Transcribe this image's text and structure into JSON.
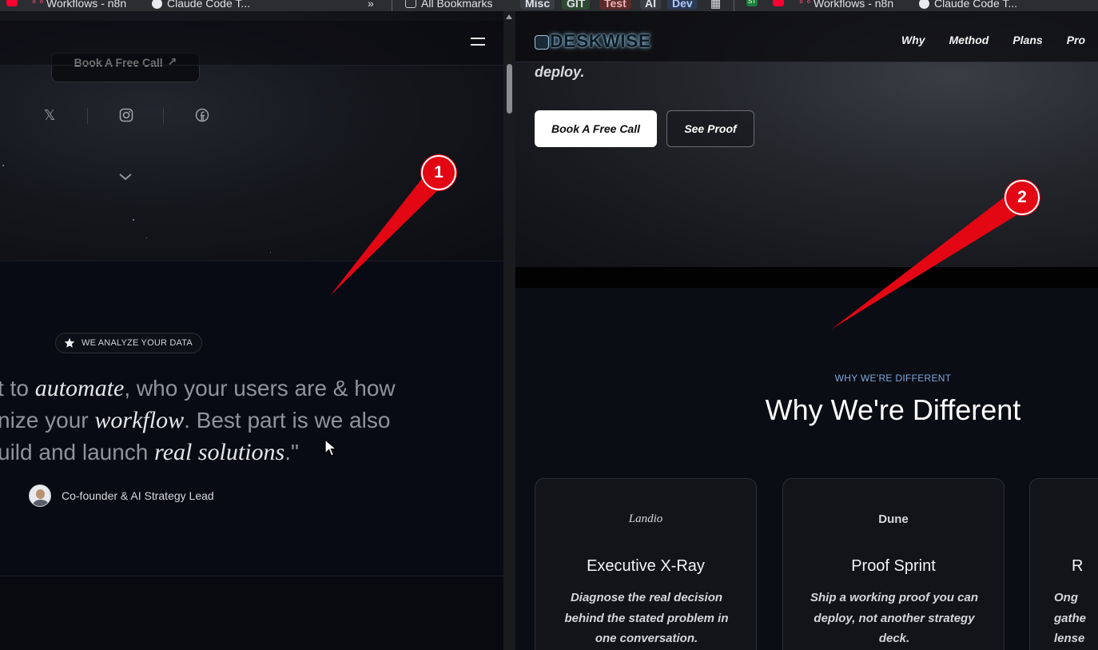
{
  "bookmarks": {
    "items": [
      {
        "label": "Workflows - n8n",
        "icon": "n8n-icon"
      },
      {
        "label": "Claude Code T...",
        "icon": "globe-icon"
      },
      {
        "label": "All Bookmarks",
        "icon": "folder-icon"
      },
      {
        "label": "Misc"
      },
      {
        "label": "GIT"
      },
      {
        "label": "Test"
      },
      {
        "label": "AI"
      },
      {
        "label": "Dev"
      },
      {
        "label": "Workflows - n8n",
        "icon": "n8n-icon"
      },
      {
        "label": "Claude Code T...",
        "icon": "globe-icon"
      }
    ],
    "overflow": "»",
    "st_label": "ST"
  },
  "left": {
    "top_button": "Book A Free Call",
    "top_button_arrow": "↗",
    "socials": [
      "x-icon",
      "instagram-icon",
      "facebook-icon"
    ],
    "badge": "WE ANALYZE YOUR DATA",
    "quote": {
      "line1_pre": "t to ",
      "line1_em": "automate",
      "line1_post": ", who your users are & how",
      "line2_pre": "nize your ",
      "line2_em": "workflow",
      "line2_post": ". Best part is we also",
      "line3_pre": "uild and launch ",
      "line3_em": "real solutions",
      "line3_post": ".\""
    },
    "author_role": "Co-founder & AI Strategy Lead"
  },
  "right": {
    "logo": "DESKWISE",
    "nav": [
      "Why",
      "Method",
      "Plans",
      "Pro"
    ],
    "hero_text": "deploy.",
    "primary_button": "Book A Free Call",
    "secondary_button": "See Proof",
    "eyebrow": "WHY WE'RE DIFFERENT",
    "section_title": "Why We're Different",
    "cards": [
      {
        "logo": "Landio",
        "title": "Executive X-Ray",
        "desc": "Diagnose the real decision behind the stated problem in one conversation."
      },
      {
        "logo": "Dune",
        "title": "Proof Sprint",
        "desc": "Ship a working proof you can deploy, not another strategy deck."
      },
      {
        "logo": "",
        "title": "R",
        "desc": "Ong gathe lense"
      }
    ]
  },
  "annotations": {
    "marker1": "1",
    "marker2": "2",
    "color": "#e30613"
  }
}
